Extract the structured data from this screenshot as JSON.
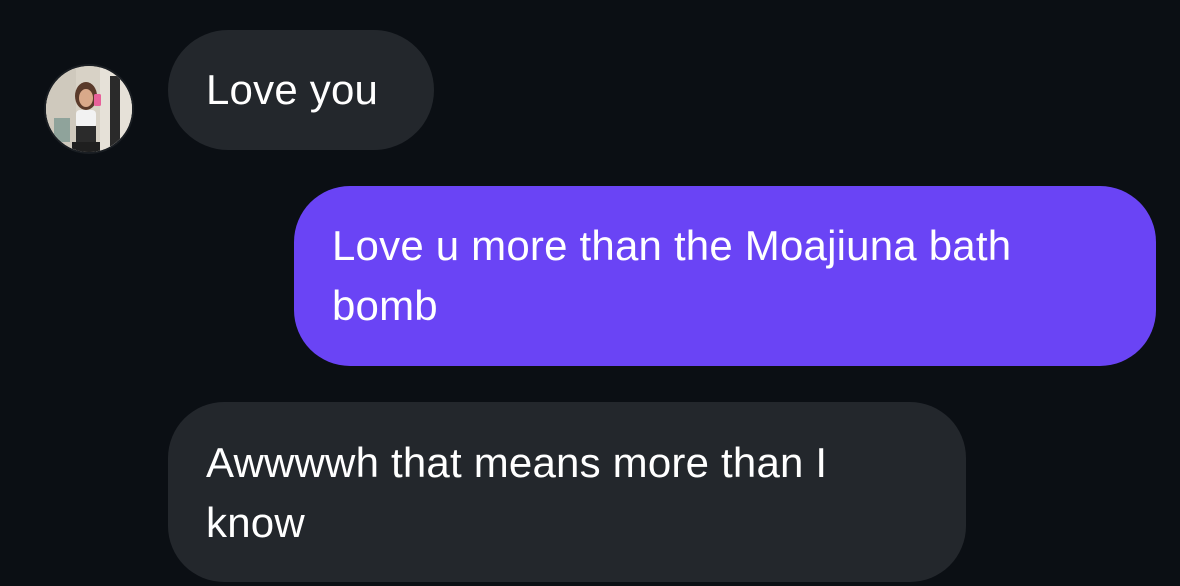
{
  "conversation": {
    "messages": [
      {
        "direction": "incoming",
        "text": "Love you"
      },
      {
        "direction": "outgoing",
        "text": "Love u more than the Moajiuna bath bomb"
      },
      {
        "direction": "incoming",
        "text": "Awwwwh that means more than I know"
      }
    ],
    "contact": {
      "avatar_icon": "avatar-photo"
    }
  },
  "theme": {
    "background": "#0b0f14",
    "incoming_bubble": "#23272c",
    "outgoing_bubble": "#6a44f5",
    "text": "#ffffff"
  }
}
